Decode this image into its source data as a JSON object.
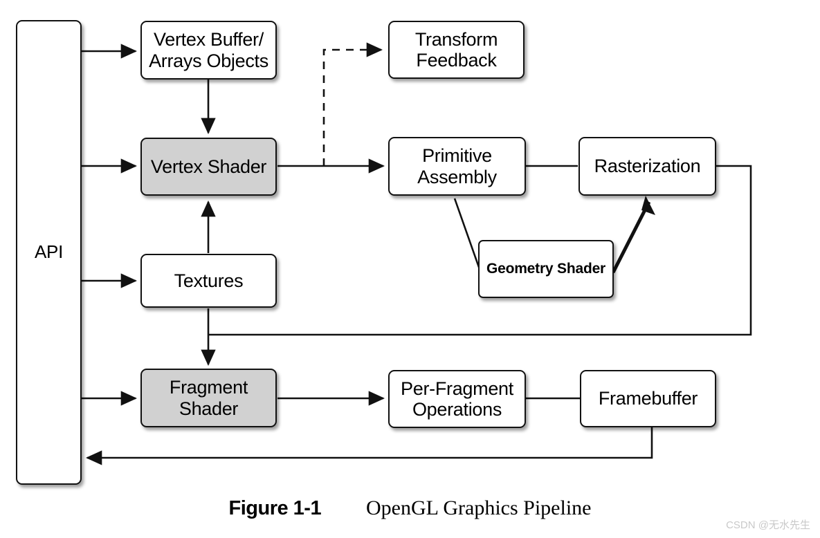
{
  "figure": {
    "number": "Figure 1-1",
    "title": "OpenGL  Graphics Pipeline",
    "watermark": "CSDN @无水先生"
  },
  "colors": {
    "shaded_node_fill": "#d1d1d1",
    "plain_node_fill": "#ffffff",
    "stroke": "#111111",
    "watermark_text": "#c9c9c9"
  },
  "nodes": {
    "api": {
      "label": "API",
      "shaded": false
    },
    "vertex_buffer": {
      "label": "Vertex Buffer/\nArrays Objects",
      "shaded": false
    },
    "vertex_shader": {
      "label": "Vertex Shader",
      "shaded": true
    },
    "textures": {
      "label": "Textures",
      "shaded": false
    },
    "fragment_shader": {
      "label": "Fragment\nShader",
      "shaded": true
    },
    "transform_feedback": {
      "label": "Transform\nFeedback",
      "shaded": false
    },
    "primitive_assembly": {
      "label": "Primitive\nAssembly",
      "shaded": false
    },
    "rasterization": {
      "label": "Rasterization",
      "shaded": false
    },
    "geometry_shader": {
      "label": "Geometry Shader",
      "shaded": false
    },
    "per_fragment_operations": {
      "label": "Per-Fragment\nOperations",
      "shaded": false
    },
    "framebuffer": {
      "label": "Framebuffer",
      "shaded": false
    }
  },
  "edges": [
    {
      "from": "api",
      "to": "vertex_buffer",
      "style": "solid",
      "arrow": true
    },
    {
      "from": "api",
      "to": "vertex_shader",
      "style": "solid",
      "arrow": true
    },
    {
      "from": "api",
      "to": "textures",
      "style": "solid",
      "arrow": true
    },
    {
      "from": "api",
      "to": "fragment_shader",
      "style": "solid",
      "arrow": true
    },
    {
      "from": "vertex_buffer",
      "to": "vertex_shader",
      "style": "solid",
      "arrow": true
    },
    {
      "from": "textures",
      "to": "vertex_shader",
      "style": "solid",
      "arrow": true
    },
    {
      "from": "textures",
      "to": "fragment_shader",
      "style": "solid",
      "arrow": true
    },
    {
      "from": "vertex_shader",
      "to": "primitive_assembly",
      "style": "solid",
      "arrow": true
    },
    {
      "from": "vertex_shader",
      "to": "transform_feedback",
      "style": "dashed",
      "arrow": true
    },
    {
      "from": "primitive_assembly",
      "to": "rasterization",
      "style": "solid",
      "arrow": false
    },
    {
      "from": "primitive_assembly",
      "to": "geometry_shader",
      "style": "solid",
      "arrow": false
    },
    {
      "from": "geometry_shader",
      "to": "rasterization",
      "style": "solid",
      "arrow": true
    },
    {
      "from": "rasterization",
      "to": "fragment_shader",
      "style": "solid",
      "arrow": true
    },
    {
      "from": "fragment_shader",
      "to": "per_fragment_operations",
      "style": "solid",
      "arrow": true
    },
    {
      "from": "per_fragment_operations",
      "to": "framebuffer",
      "style": "solid",
      "arrow": false
    },
    {
      "from": "framebuffer",
      "to": "api",
      "style": "solid",
      "arrow": true
    }
  ]
}
